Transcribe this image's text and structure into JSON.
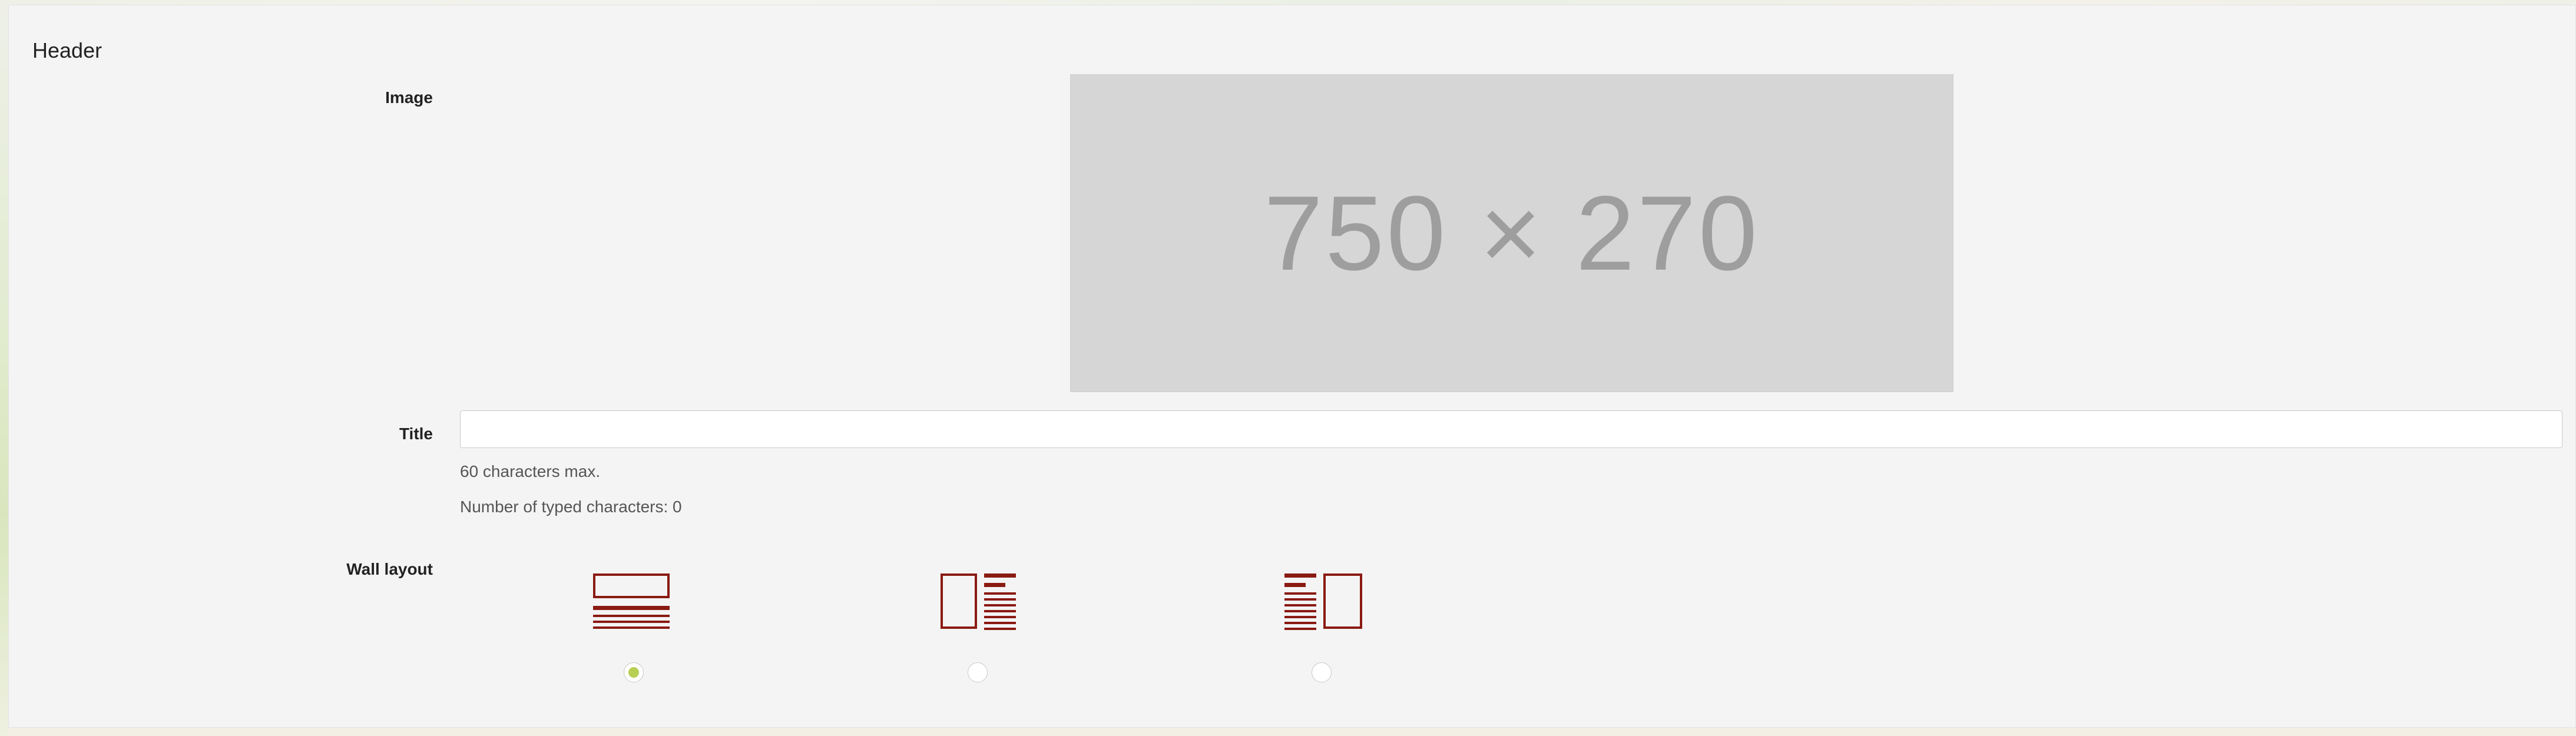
{
  "section": {
    "title": "Header"
  },
  "image": {
    "label": "Image",
    "placeholder_text": "750 × 270"
  },
  "title_field": {
    "label": "Title",
    "value": "",
    "help": "60 characters max.",
    "counter": "Number of typed characters: 0"
  },
  "wall_layout": {
    "label": "Wall layout",
    "options": [
      {
        "icon": "layout-image-top-icon",
        "selected": true
      },
      {
        "icon": "layout-image-left-icon",
        "selected": false
      },
      {
        "icon": "layout-image-right-icon",
        "selected": false
      }
    ],
    "icon_color": "#8a1a12",
    "radio_selected_color": "#b7cf53"
  }
}
